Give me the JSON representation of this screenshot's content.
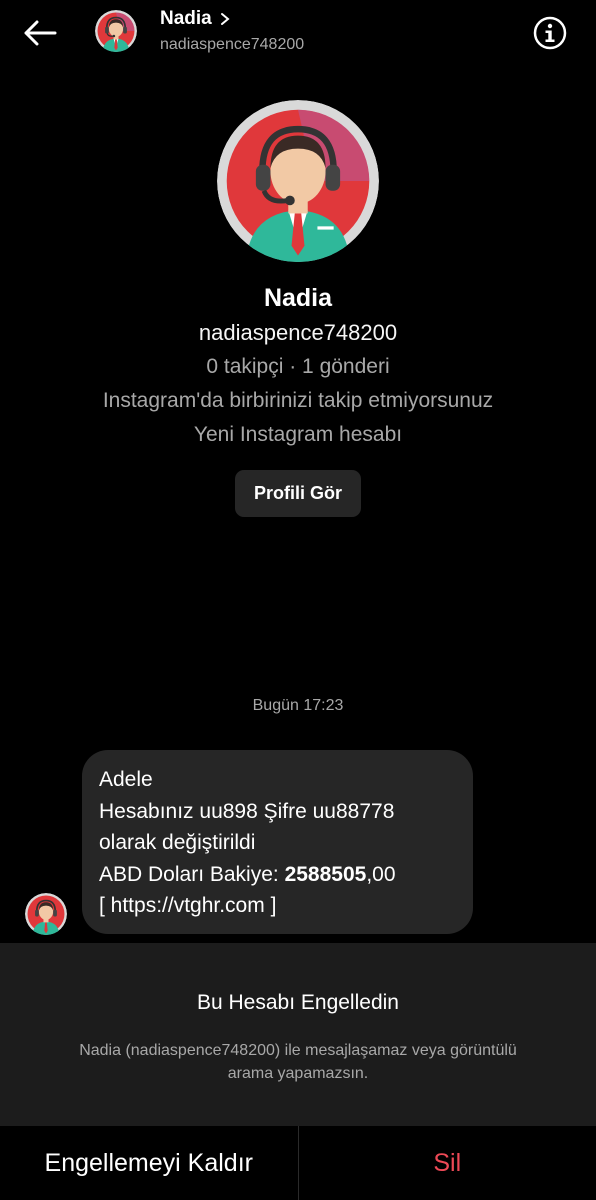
{
  "header": {
    "name": "Nadia",
    "username": "nadiaspence748200",
    "icons": {
      "back": "arrow-left-icon",
      "chevron": "chevron-right-icon",
      "info": "info-icon"
    }
  },
  "profile": {
    "name": "Nadia",
    "username": "nadiaspence748200",
    "stats": "0 takipçi · 1 gönderi",
    "note1": "Instagram'da birbirinizi takip etmiyorsunuz",
    "note2": "Yeni Instagram hesabı",
    "view_profile_label": "Profili Gör"
  },
  "conversation": {
    "timestamp": "Bugün 17:23",
    "message": {
      "line1": "Adele",
      "line2": "Hesabınız uu898 Şifre uu88778",
      "line3": "olarak değiştirildi",
      "line4_prefix": "ABD Doları Bakiye: ",
      "line4_bold": "2588505",
      "line4_suffix": ",00",
      "line5": "[ https://vtghr.com ]"
    }
  },
  "blocked": {
    "title": "Bu Hesabı Engelledin",
    "description": "Nadia (nadiaspence748200) ile mesajlaşamaz veya görüntülü arama yapamazsın."
  },
  "actions": {
    "unblock_label": "Engellemeyi Kaldır",
    "delete_label": "Sil"
  },
  "colors": {
    "background": "#000000",
    "bubble": "#262626",
    "panel": "#1c1c1c",
    "secondary_text": "#a8a8a8",
    "danger": "#ed4956",
    "avatar_ring": "#cfcfcf",
    "avatar_bg": "#e0383b",
    "avatar_shirt": "#2fb89a",
    "avatar_tie": "#e0383b"
  }
}
